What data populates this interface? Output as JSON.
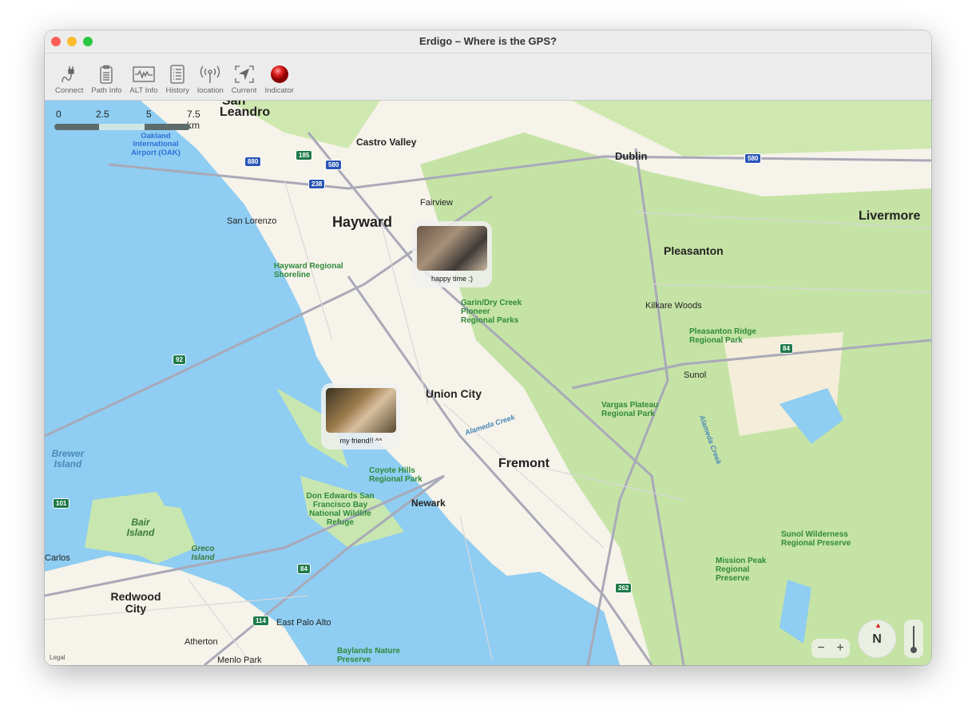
{
  "window": {
    "title": "Erdigo – Where is the GPS?"
  },
  "toolbar": [
    {
      "label": "Connect",
      "icon": "plug-icon"
    },
    {
      "label": "Path Info",
      "icon": "clipboard-icon"
    },
    {
      "label": "ALT Info",
      "icon": "waveform-icon"
    },
    {
      "label": "History",
      "icon": "list-icon"
    },
    {
      "label": "location",
      "icon": "antenna-icon"
    },
    {
      "label": "Current",
      "icon": "location-arrow-icon"
    },
    {
      "label": "Indicator",
      "icon": "red-indicator-icon"
    }
  ],
  "scale": {
    "ticks": [
      "0",
      "2.5",
      "5",
      "7.5 km"
    ]
  },
  "map": {
    "labels": {
      "san_leandro_top": "San",
      "san_leandro": "Leandro",
      "castro_valley": "Castro Valley",
      "dublin": "Dublin",
      "fairview": "Fairview",
      "hayward": "Hayward",
      "san_lorenzo": "San Lorenzo",
      "livermore": "Livermore",
      "pleasanton": "Pleasanton",
      "kilkare": "Kilkare Woods",
      "sunol": "Sunol",
      "union_city": "Union City",
      "fremont": "Fremont",
      "newark": "Newark",
      "brewer": "Brewer Island",
      "bair": "Bair Island",
      "greco": "Greco Island",
      "carlos": "Carlos",
      "redwood": "Redwood City",
      "east_palo_alto": "East Palo Alto",
      "atherton": "Atherton",
      "menlo": "Menlo Park",
      "oak": "Oakland International Airport (OAK)",
      "hayward_shore": "Hayward Regional Shoreline",
      "garin": "Garin/Dry Creek Pioneer Regional Parks",
      "pleas_ridge": "Pleasanton Ridge Regional Park",
      "vargas": "Vargas Plateau Regional Park",
      "coyote": "Coyote Hills Regional Park",
      "don_edwards": "Don Edwards San Francisco Bay National Wildlife Refuge",
      "sunol_wild": "Sunol Wilderness Regional Preserve",
      "mission_peak": "Mission Peak Regional Preserve",
      "baylands": "Baylands Nature Preserve",
      "alameda1": "Alameda Creek",
      "alameda2": "Alameda Creek",
      "legal": "Legal"
    },
    "shields": [
      "880",
      "185",
      "580",
      "238",
      "580",
      "92",
      "84",
      "84",
      "101",
      "114",
      "262"
    ],
    "photos": [
      {
        "caption": "happy time :)"
      },
      {
        "caption": "my friend!! ^^"
      }
    ]
  },
  "controls": {
    "zoom_out": "−",
    "zoom_in": "+",
    "compass": "N"
  },
  "colors": {
    "water": "#8fcdf2",
    "land": "#f6f3ea",
    "park": "#c8e6a8",
    "accent_red": "#d42020"
  }
}
